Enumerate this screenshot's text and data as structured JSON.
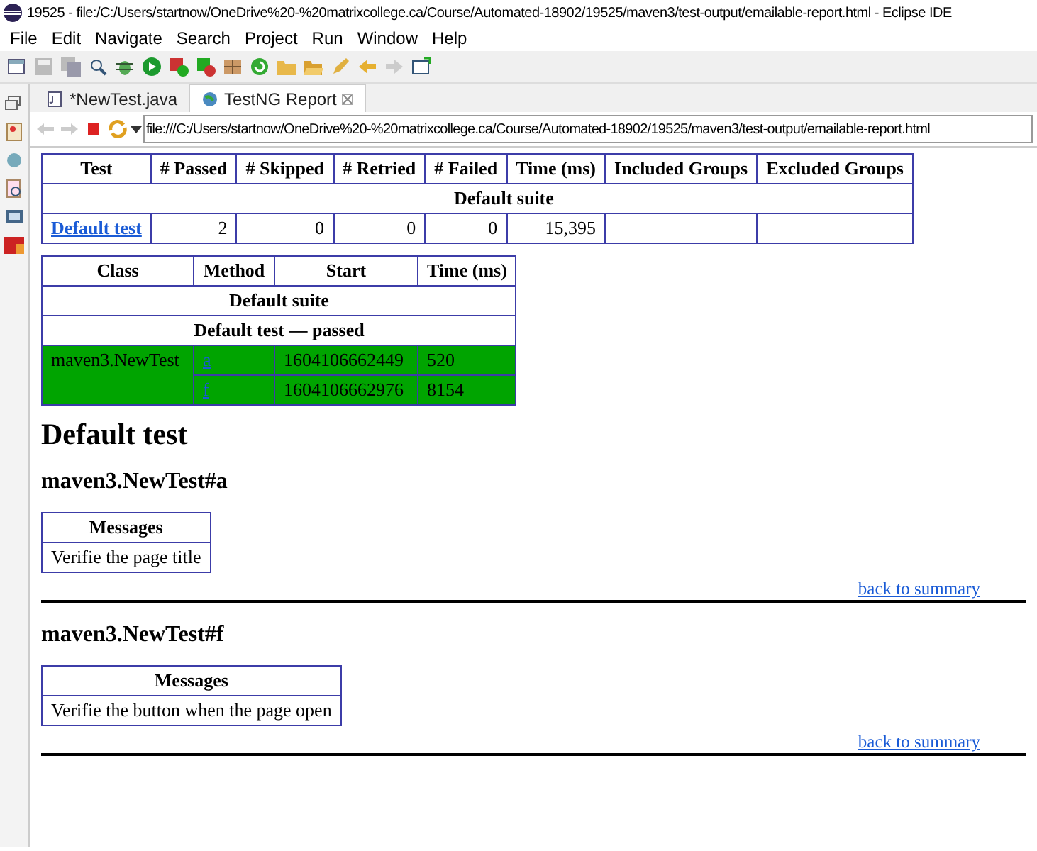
{
  "window": {
    "title": "19525 - file:/C:/Users/startnow/OneDrive%20-%20matrixcollege.ca/Course/Automated-18902/19525/maven3/test-output/emailable-report.html - Eclipse IDE"
  },
  "menu": [
    "File",
    "Edit",
    "Navigate",
    "Search",
    "Project",
    "Run",
    "Window",
    "Help"
  ],
  "editor_tabs": [
    {
      "label": "*NewTest.java",
      "selected": false
    },
    {
      "label": "TestNG Report",
      "selected": true
    }
  ],
  "address_bar": {
    "value": "file:///C:/Users/startnow/OneDrive%20-%20matrixcollege.ca/Course/Automated-18902/19525/maven3/test-output/emailable-report.html"
  },
  "summary_table": {
    "columns": [
      "Test",
      "# Passed",
      "# Skipped",
      "# Retried",
      "# Failed",
      "Time (ms)",
      "Included Groups",
      "Excluded Groups"
    ],
    "suite": "Default suite",
    "rows": [
      {
        "test": "Default test",
        "passed": "2",
        "skipped": "0",
        "retried": "0",
        "failed": "0",
        "time": "15,395"
      }
    ]
  },
  "methods_table": {
    "columns": [
      "Class",
      "Method",
      "Start",
      "Time (ms)"
    ],
    "suite": "Default suite",
    "group_heading": "Default test — passed",
    "class_name": "maven3.NewTest",
    "rows": [
      {
        "method": "a",
        "start": "1604106662449",
        "time": "520"
      },
      {
        "method": "f",
        "start": "1604106662976",
        "time": "8154"
      }
    ]
  },
  "heading": "Default test",
  "tests": [
    {
      "title": "maven3.NewTest#a",
      "messages_header": "Messages",
      "message": "Verifie the page title",
      "back_link": "back to summary"
    },
    {
      "title": "maven3.NewTest#f",
      "messages_header": "Messages",
      "message": "Verifie the button when the page open",
      "back_link": "back to summary"
    }
  ]
}
